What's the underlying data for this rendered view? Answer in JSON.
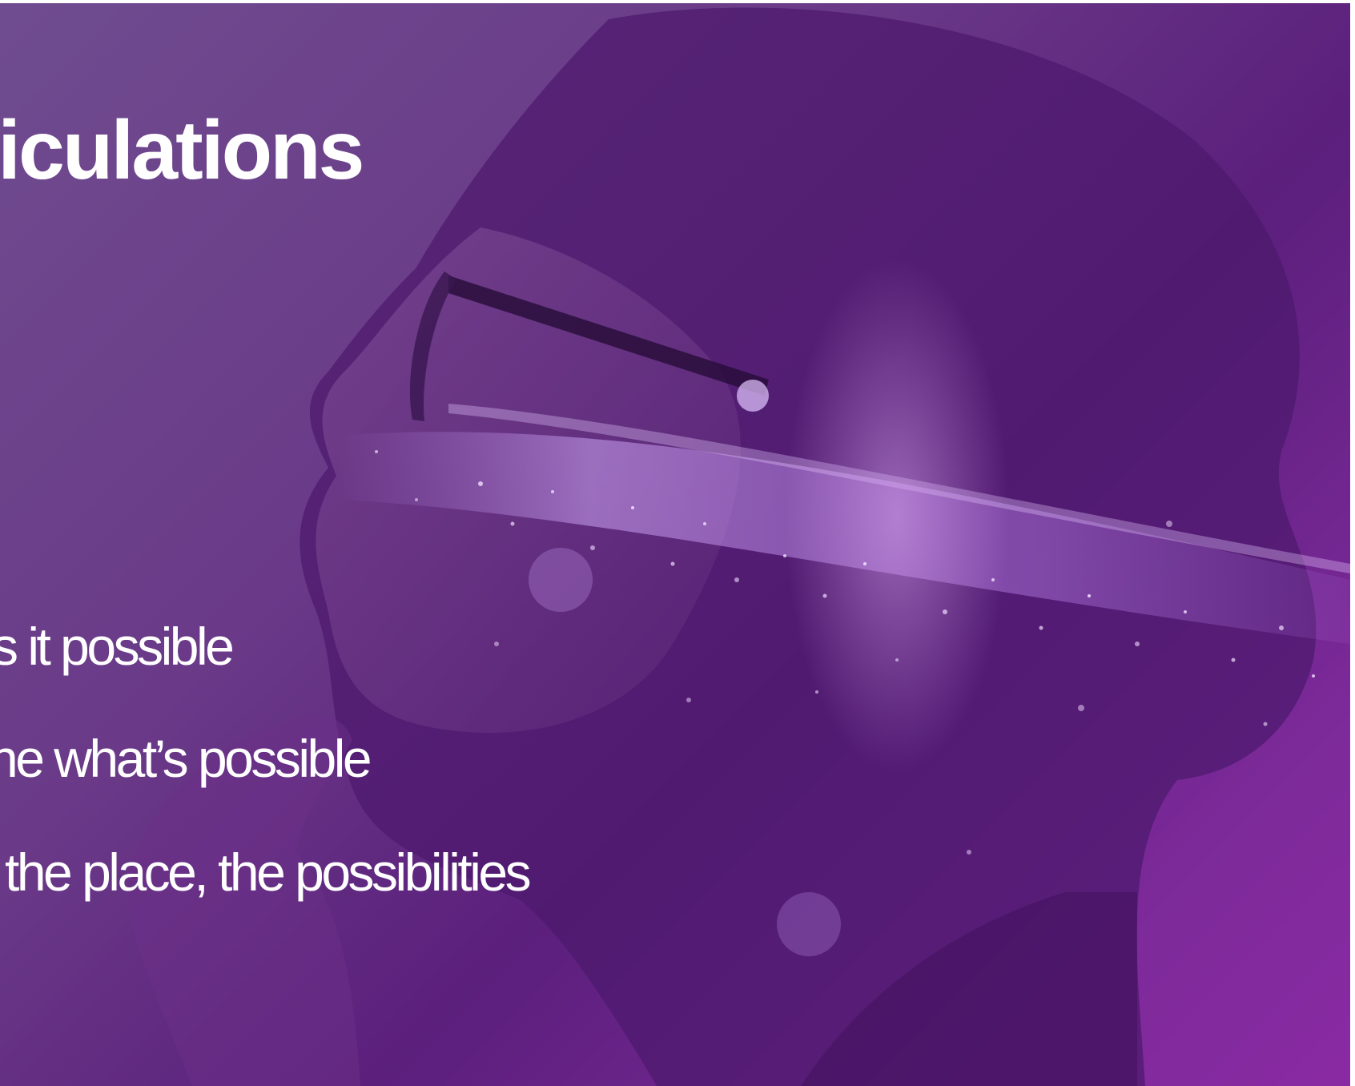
{
  "slide": {
    "headline": "rticulations",
    "lines": [
      "s it possible",
      "ne what’s possible",
      "the place, the possibilities"
    ]
  },
  "background": {
    "image": "woman-profile-with-glasses-and-glowing-particle-stream",
    "tint_color": "#6a2a8c",
    "accent_glow": "#c07ae0"
  }
}
